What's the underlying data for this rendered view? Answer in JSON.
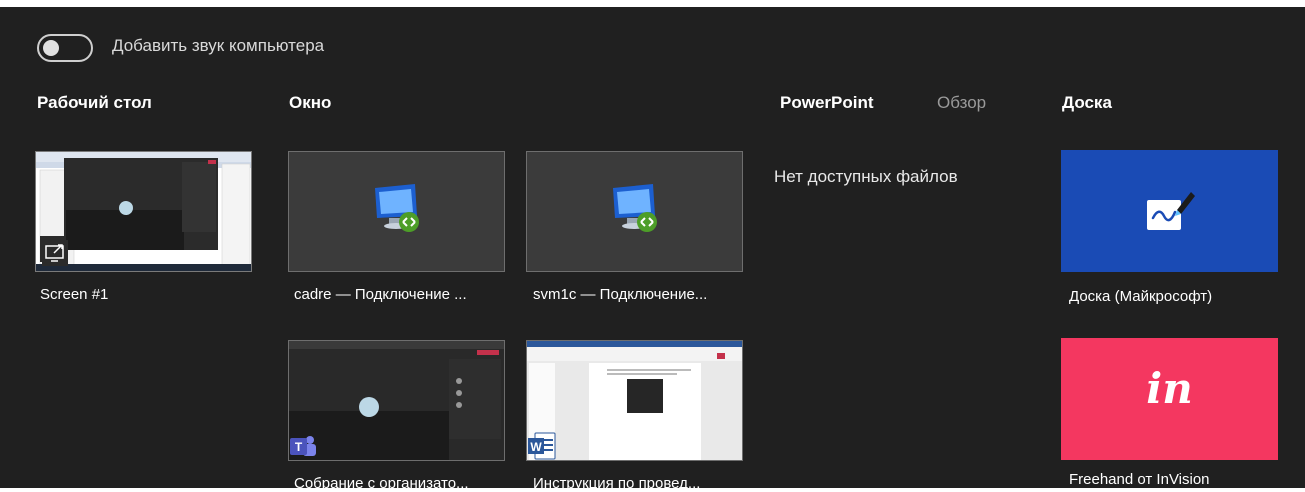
{
  "audio_toggle": {
    "label": "Добавить звук компьютера",
    "on": false
  },
  "sections": {
    "desktop": "Рабочий стол",
    "window": "Окно",
    "powerpoint": "PowerPoint",
    "browse": "Обзор",
    "whiteboard": "Доска"
  },
  "powerpoint_empty": "Нет доступных файлов",
  "desktop_items": [
    {
      "caption": "Screen #1",
      "icon": "share-screen-icon"
    }
  ],
  "window_items": [
    {
      "caption": "cadre — Подключение ...",
      "icon": "remote-desktop-icon"
    },
    {
      "caption": "svm1c — Подключение...",
      "icon": "remote-desktop-icon"
    },
    {
      "caption": "Собрание с организато...",
      "icon": "teams-icon"
    },
    {
      "caption": "Инструкция по провед...",
      "icon": "word-icon"
    }
  ],
  "whiteboard_items": [
    {
      "caption": "Доска (Майкрософт)",
      "icon": "whiteboard-icon",
      "color": "#1a4bb5"
    },
    {
      "caption": "Freehand от InVision",
      "icon": "invision-icon",
      "logo_text": "in",
      "color": "#f43760"
    }
  ],
  "colors": {
    "background": "#202020",
    "tile": "#3b3b3b",
    "text": "#ffffff",
    "muted": "#9a9a9a"
  }
}
